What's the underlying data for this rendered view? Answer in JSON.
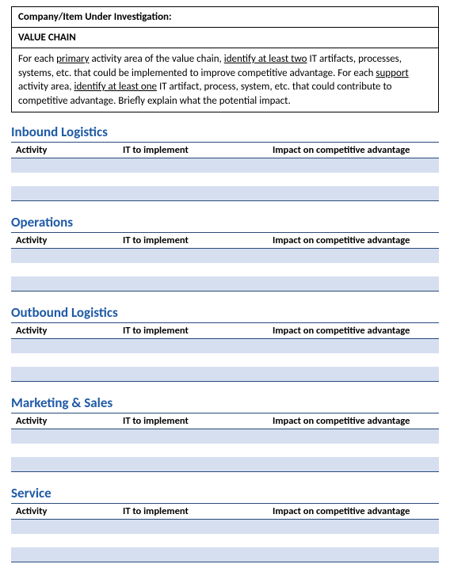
{
  "header": {
    "label": "Company/Item Under Investigation:",
    "title": "VALUE CHAIN",
    "instructions_pre": "For each ",
    "u1": "primary",
    "instructions_mid1": " activity area of the value chain, ",
    "u2": "identify at least two",
    "instructions_mid2": " IT artifacts, processes, systems, etc. that could be implemented to improve competitive advantage. For each ",
    "u3": "support",
    "instructions_mid3": " activity area, ",
    "u4": "identify at least one",
    "instructions_end": " IT artifact, process, system, etc. that could contribute to competitive advantage. Briefly explain what the potential impact."
  },
  "columns": {
    "activity": "Activity",
    "it": "IT to implement",
    "impact": "Impact on competitive advantage"
  },
  "sections": [
    {
      "title": "Inbound Logistics"
    },
    {
      "title": "Operations"
    },
    {
      "title": "Outbound Logistics"
    },
    {
      "title": "Marketing & Sales"
    },
    {
      "title": "Service"
    }
  ]
}
